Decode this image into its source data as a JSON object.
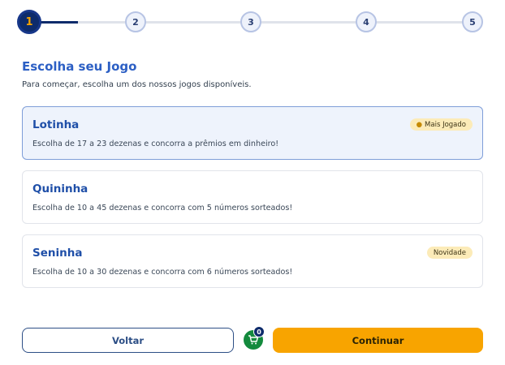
{
  "stepper": {
    "steps": [
      {
        "label": "1",
        "state": "active"
      },
      {
        "label": "2",
        "state": "pending"
      },
      {
        "label": "3",
        "state": "pending"
      },
      {
        "label": "4",
        "state": "pending"
      },
      {
        "label": "5",
        "state": "pending"
      }
    ]
  },
  "header": {
    "title": "Escolha seu Jogo",
    "subtitle": "Para começar, escolha um dos nossos jogos disponíveis."
  },
  "games": [
    {
      "name": "Lotinha",
      "description": "Escolha de 17 a 23 dezenas e concorra a prêmios em dinheiro!",
      "badge": "Mais Jogado",
      "badge_icon": "fire-icon",
      "selected": true
    },
    {
      "name": "Quininha",
      "description": "Escolha de 10 a 45 dezenas e concorra com 5 números sorteados!",
      "selected": false
    },
    {
      "name": "Seninha",
      "description": "Escolha de 10 a 30 dezenas e concorra com 6 números sorteados!",
      "badge": "Novidade",
      "selected": false
    }
  ],
  "footer": {
    "back_label": "Voltar",
    "next_label": "Continuar",
    "cart_count": "0",
    "cart_icon": "cart-icon"
  },
  "colors": {
    "primary": "#0d2b6b",
    "accent": "#f8a400",
    "link_blue": "#2c5fc4",
    "cart_green": "#138a3d"
  }
}
